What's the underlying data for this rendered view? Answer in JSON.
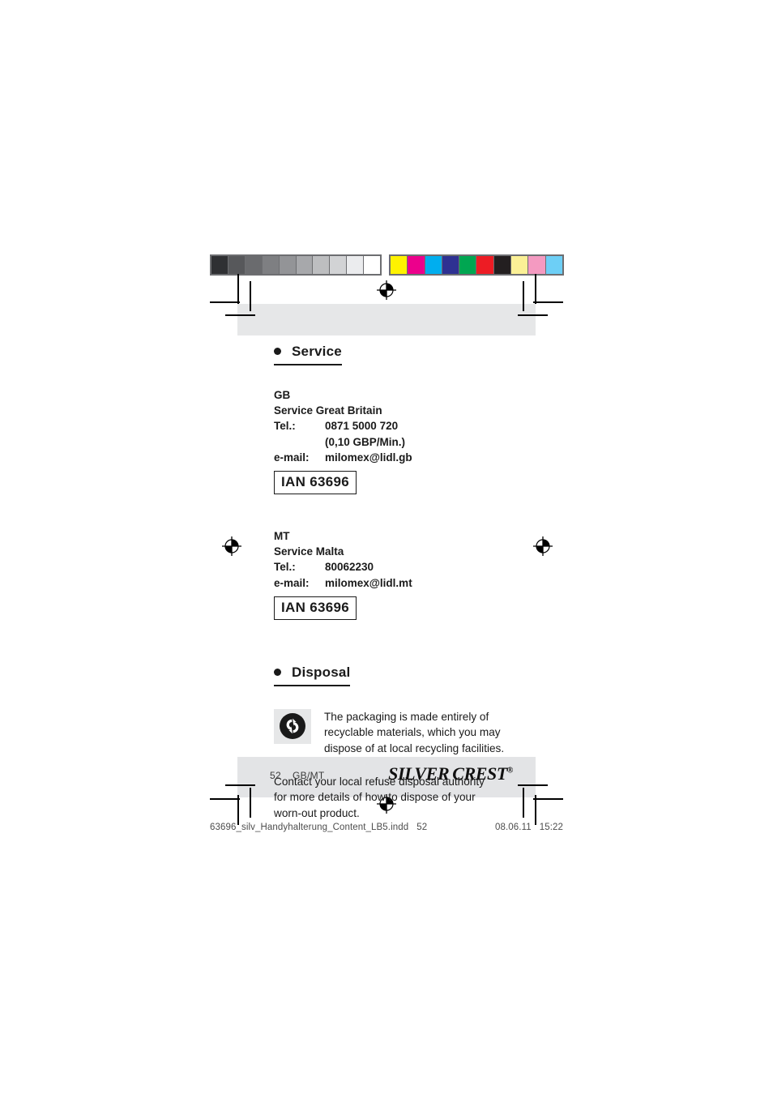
{
  "document": {
    "page_number": "52",
    "locale": "GB/MT",
    "brand_primary": "SILVER",
    "brand_secondary": "CREST",
    "brand_trademark": "®"
  },
  "colorbar": {
    "grayscale": [
      "#2f3033",
      "#57585b",
      "#6a6b6e",
      "#7e7f82",
      "#939497",
      "#a7a8ab",
      "#bdbec0",
      "#d2d3d5",
      "#ebecee",
      "#ffffff"
    ],
    "process": [
      "#fff200",
      "#ec008c",
      "#00aeef",
      "#2e3192",
      "#00a651",
      "#ed1c24",
      "#231f20",
      "#fbf096",
      "#f49ac1",
      "#6dcff6"
    ]
  },
  "service_section": {
    "heading": "Service",
    "bullet_icon": "bullet-dot-icon",
    "countries": [
      {
        "code": "GB",
        "name": "Service Great Britain",
        "tel_label": "Tel.:",
        "tel_value": "0871 5000 720",
        "tel_rate": "(0,10 GBP/Min.)",
        "email_label": "e-mail:",
        "email_value": "milomex@lidl.gb",
        "ian": "IAN 63696"
      },
      {
        "code": "MT",
        "name": "Service Malta",
        "tel_label": "Tel.:",
        "tel_value": "80062230",
        "tel_rate": "",
        "email_label": "e-mail:",
        "email_value": "milomex@lidl.mt",
        "ian": "IAN 63696"
      }
    ]
  },
  "disposal_section": {
    "heading": "Disposal",
    "bullet_icon": "bullet-dot-icon",
    "recycle_icon": "green-dot-recycling-icon",
    "recycle_text": "The packaging is made entirely of recyclable materials, which you may dispose of at local recycling facilities.",
    "paragraph": "Contact your local refuse disposal authority for more details of how to dispose of your worn-out product."
  },
  "print_slug": {
    "filename": "63696_silv_Handyhalterung_Content_LB5.indd",
    "page": "52",
    "date": "08.06.11",
    "time": "15:22"
  }
}
